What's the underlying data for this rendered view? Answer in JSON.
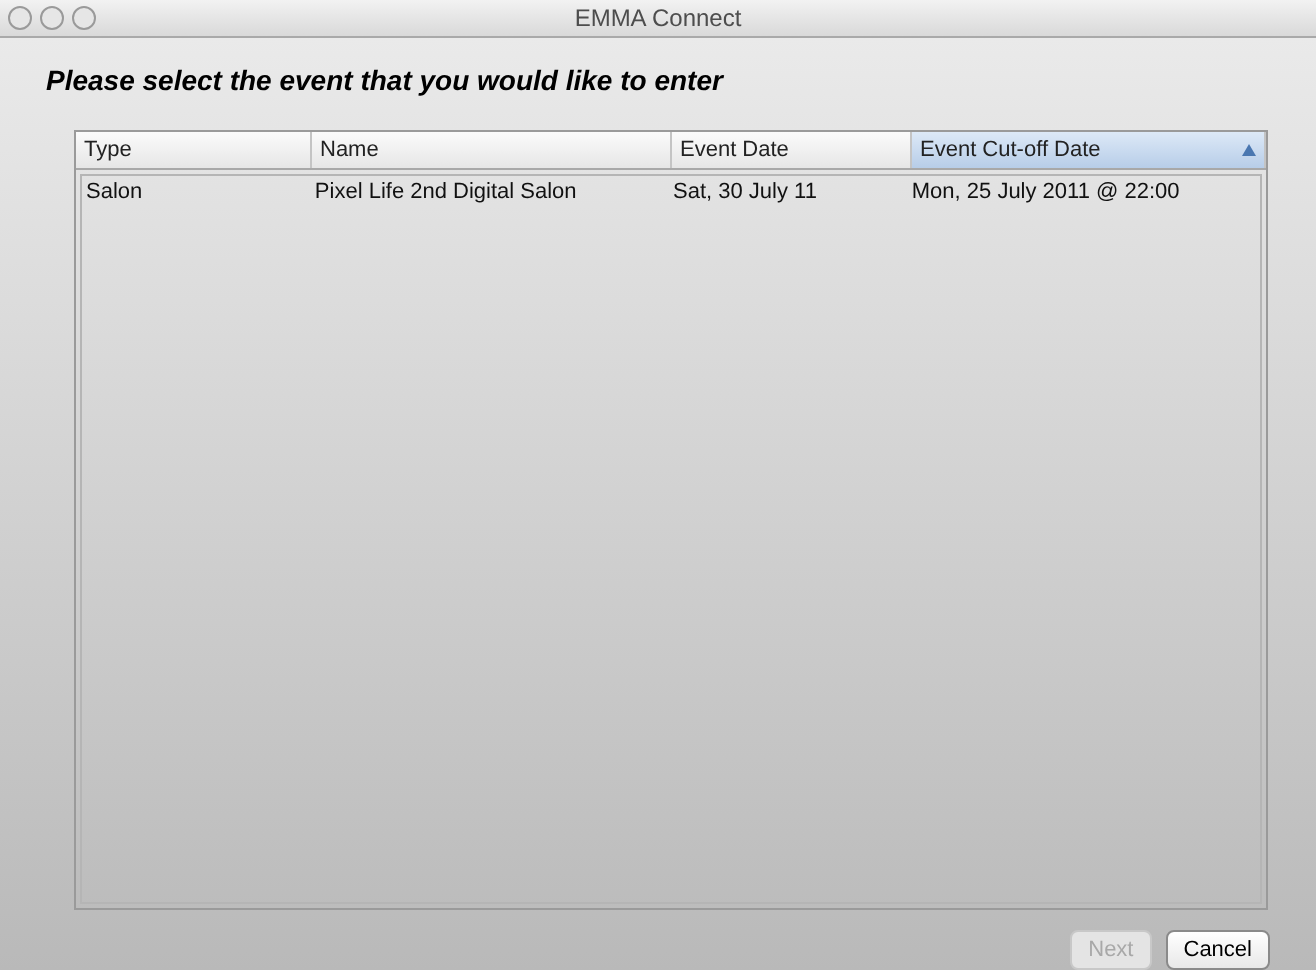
{
  "window": {
    "title": "EMMA Connect"
  },
  "heading": "Please select the event that you would like to enter",
  "table": {
    "columns": [
      {
        "label": "Type",
        "selected": false
      },
      {
        "label": "Name",
        "selected": false
      },
      {
        "label": "Event Date",
        "selected": false
      },
      {
        "label": "Event Cut-off Date",
        "selected": true
      }
    ],
    "rows": [
      {
        "cells": [
          "Salon",
          "Pixel Life 2nd Digital Salon",
          "Sat, 30 July 11",
          "Mon, 25 July 2011 @ 22:00"
        ],
        "selected": false
      }
    ]
  },
  "buttons": [
    {
      "label": "Next",
      "disabled": true
    },
    {
      "label": "Cancel",
      "disabled": false
    }
  ]
}
